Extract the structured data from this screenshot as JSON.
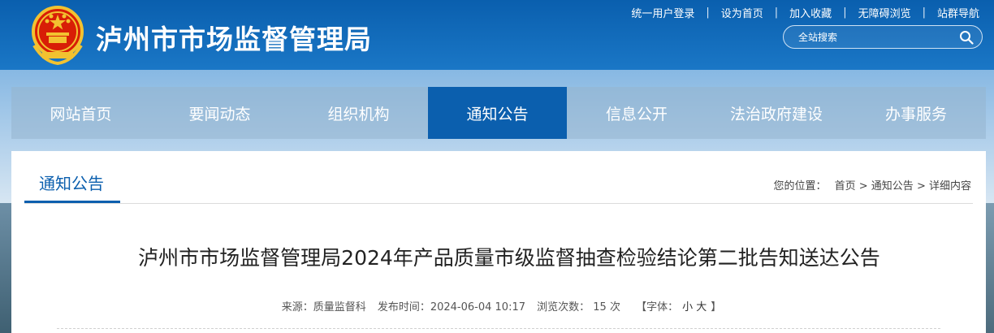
{
  "header": {
    "site_title": "泸州市市场监督管理局",
    "emblem_icon": "national-emblem",
    "top_links": [
      "统一用户登录",
      "设为首页",
      "加入收藏",
      "无障碍浏览",
      "站群导航"
    ],
    "search": {
      "placeholder": "全站搜索",
      "icon": "search-icon"
    }
  },
  "nav": {
    "items": [
      "网站首页",
      "要闻动态",
      "组织机构",
      "通知公告",
      "信息公开",
      "法治政府建设",
      "办事服务"
    ],
    "active_index": 3,
    "active_color": "#0b5fae"
  },
  "content": {
    "section_title": "通知公告",
    "breadcrumb": {
      "prefix": "您的位置：",
      "home": "首页",
      "sep1": " > ",
      "section": "通知公告",
      "sep2": " > ",
      "current": "详细内容"
    },
    "article_title": "泸州市市场监督管理局2024年产品质量市级监督抽查检验结论第二批告知送达公告",
    "meta": {
      "source": "来源：质量监督科",
      "published": "发布时间：2024-06-04 10:17",
      "views": "浏览次数： 15  次",
      "font_open": "【字体：",
      "font_small": "小",
      "font_large": "大",
      "font_close": "】"
    }
  }
}
